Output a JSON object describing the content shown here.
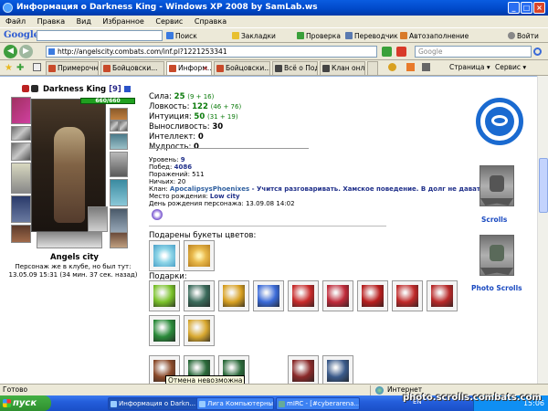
{
  "window": {
    "title": "Информация о Darkness King - Windows XP 2008 by SamLab.ws"
  },
  "menu": [
    "Файл",
    "Правка",
    "Вид",
    "Избранное",
    "Сервис",
    "Справка"
  ],
  "google_toolbar": {
    "logo": "Google",
    "search_label": "Поиск",
    "bookmarks_label": "Закладки",
    "check_label": "Проверка",
    "translate_label": "Переводчик",
    "autofill_label": "Автозаполнение",
    "login_label": "Войти"
  },
  "address": {
    "url": "http://angelscity.combats.com/inf.pl?1221253341",
    "search_placeholder": "Google"
  },
  "tabs": [
    {
      "label": "Примерочн...",
      "active": false
    },
    {
      "label": "Бойцовски...",
      "active": false
    },
    {
      "label": "Информ...",
      "active": true
    },
    {
      "label": "Бойцовски...",
      "active": false
    },
    {
      "label": "Всё о Подзе...",
      "active": false
    },
    {
      "label": "Клан онла...",
      "active": false
    }
  ],
  "page_tools": {
    "page_label": "Страница",
    "service_label": "Сервис"
  },
  "character": {
    "name": "Darkness King",
    "level": "[9]",
    "hp": "660/660",
    "city": "Angels city",
    "in_club_line1": "Персонаж же в клубе, но был тут:",
    "in_club_line2": "13.05.09 15:31 (34 мин. 37 сек. назад)"
  },
  "stats": [
    {
      "label": "Сила:",
      "value": "25",
      "extra": "(9 + 16)"
    },
    {
      "label": "Ловкость:",
      "value": "122",
      "extra": "(46 + 76)"
    },
    {
      "label": "Интуиция:",
      "value": "50",
      "extra": "(31 + 19)"
    },
    {
      "label": "Выносливость:",
      "value": "30",
      "extra": ""
    },
    {
      "label": "Интеллект:",
      "value": "0",
      "extra": ""
    },
    {
      "label": "Мудрость:",
      "value": "0",
      "extra": ""
    }
  ],
  "info": {
    "level_label": "Уровень:",
    "level_value": "9",
    "wins_label": "Побед:",
    "wins_value": "4086",
    "losses_label": "Поражений:",
    "losses_value": "511",
    "draws_label": "Ничьих:",
    "draws_value": "20",
    "clan_label": "Клан:",
    "clan_value": "ApocalipsysPhoenixes",
    "clan_motto": " - Учится разговаривать. Хамское поведение. В долг не давать",
    "birthplace_label": "Место рождения:",
    "birthplace_value": "Low city",
    "birthday_label": "День рождения персонажа:",
    "birthday_value": "13.09.08 14:02"
  },
  "bouquets_label": "Подарены букеты цветов:",
  "gifts_label": "Подарки:",
  "bouquets": [
    {
      "color": "#8fd6e8"
    },
    {
      "color": "#e8b84a"
    }
  ],
  "gifts": [
    {
      "color": "#7ac22a"
    },
    {
      "color": "#3a6a5a"
    },
    {
      "color": "#d8a020"
    },
    {
      "color": "#3a6ad8"
    },
    {
      "color": "#c82a2a"
    },
    {
      "color": "#c02a3a"
    },
    {
      "color": "#b81e1e"
    },
    {
      "color": "#c02a2a"
    },
    {
      "color": "#b82828"
    },
    {
      "color": "#2a8a3a"
    },
    {
      "color": "#d8a830"
    }
  ],
  "bottom_gifts": [
    {
      "color": "#8a4a2a"
    },
    {
      "color": "#2a6a3a"
    },
    {
      "color": "#2a6a3a"
    },
    {
      "color": "#8a2a2a"
    },
    {
      "color": "#3a5a8a"
    }
  ],
  "right": {
    "scrolls_label": "Scrolls",
    "photo_scrolls_label": "Photo Scrolls"
  },
  "tooltip": "Отмена невозможна",
  "status": {
    "left": "Готово",
    "zone": "Интернет"
  },
  "taskbar": {
    "start": "пуск",
    "tasks": [
      {
        "label": "Информация о Darkn...",
        "active": true
      },
      {
        "label": "Лига Компьютерны...",
        "active": false
      },
      {
        "label": "mIRC - [#cyberarena...",
        "active": false
      }
    ],
    "lang": "EN",
    "clock": "15:06"
  },
  "watermark": "photo.scrolls.combats.com"
}
